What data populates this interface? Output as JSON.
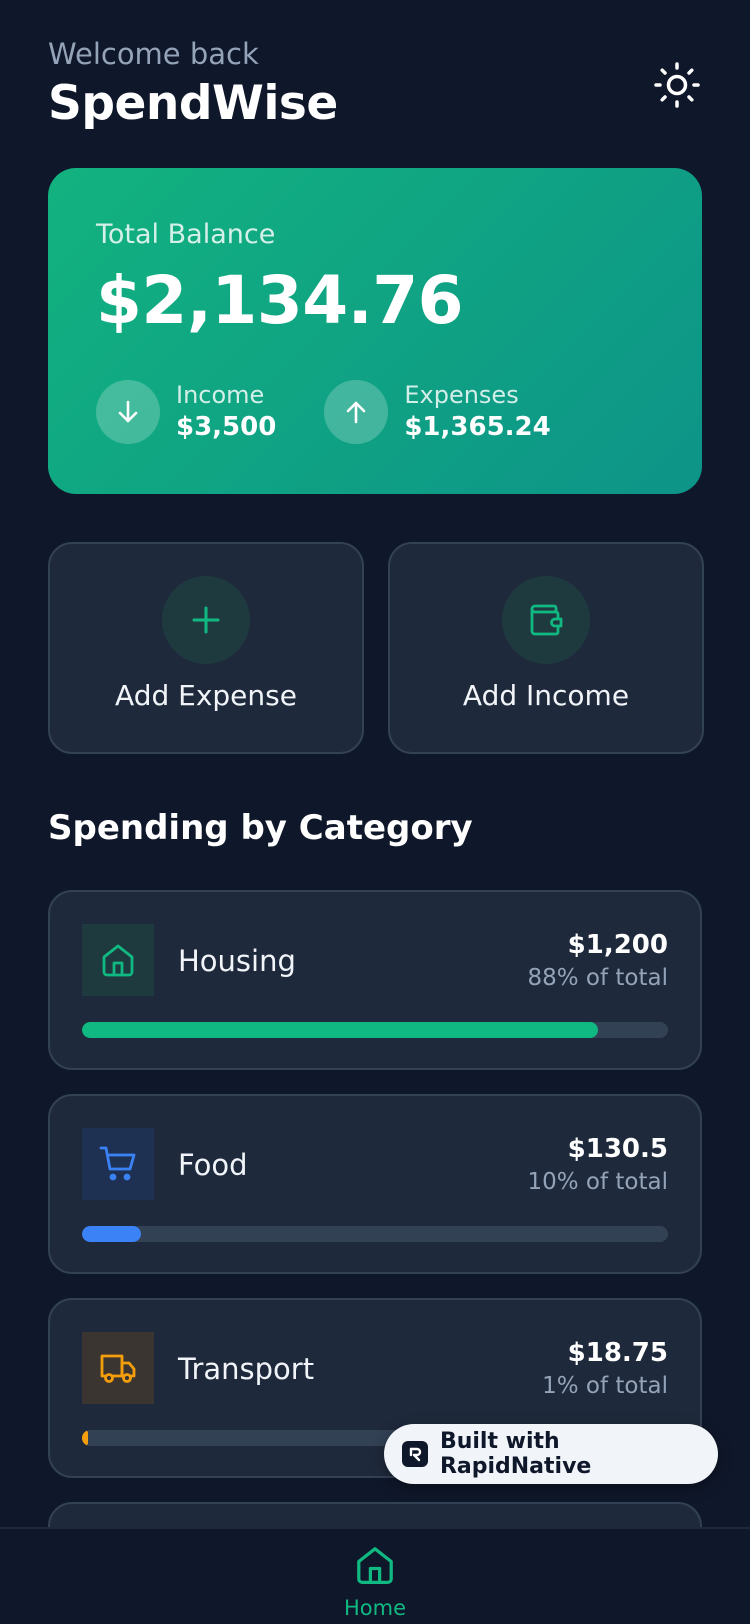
{
  "header": {
    "welcome": "Welcome back",
    "title": "SpendWise",
    "theme_icon": "sun-icon"
  },
  "balance": {
    "label": "Total Balance",
    "amount": "$2,134.76",
    "income_label": "Income",
    "income_value": "$3,500",
    "expenses_label": "Expenses",
    "expenses_value": "$1,365.24"
  },
  "actions": {
    "add_expense": "Add Expense",
    "add_income": "Add Income"
  },
  "spending": {
    "title": "Spending by Category",
    "categories": [
      {
        "name": "Housing",
        "amount": "$1,200",
        "pct_label": "88% of total",
        "fraction": 0.88,
        "color": "#10b981",
        "icon": "home-icon"
      },
      {
        "name": "Food",
        "amount": "$130.5",
        "pct_label": "10% of total",
        "fraction": 0.1,
        "color": "#3b82f6",
        "icon": "shopping-cart-icon"
      },
      {
        "name": "Transport",
        "amount": "$18.75",
        "pct_label": "1% of total",
        "fraction": 0.01,
        "color": "#f59e0b",
        "icon": "truck-icon"
      }
    ]
  },
  "badge": {
    "text": "Built with RapidNative"
  },
  "tabbar": {
    "home_label": "Home"
  },
  "colors": {
    "background": "#0f172a",
    "card": "#1e293b",
    "accent": "#10b981"
  }
}
